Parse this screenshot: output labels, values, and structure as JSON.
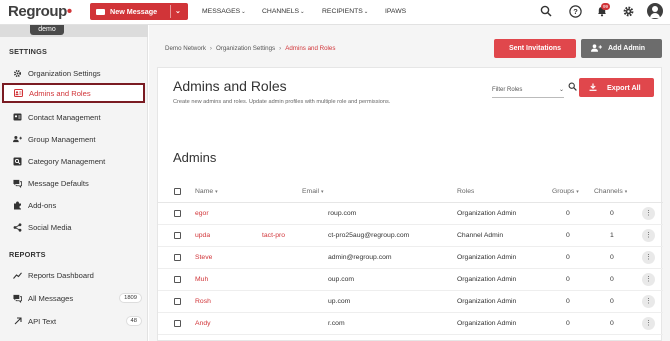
{
  "header": {
    "logo": "Regroup",
    "new_message_label": "New Message",
    "nav": [
      {
        "label": "MESSAGES",
        "has_dropdown": true
      },
      {
        "label": "CHANNELS",
        "has_dropdown": true
      },
      {
        "label": "RECIPIENTS",
        "has_dropdown": true
      },
      {
        "label": "IPAWS",
        "has_dropdown": false
      }
    ],
    "notification_count": "99"
  },
  "account_label": "demo",
  "sidebar": {
    "settings_heading": "SETTINGS",
    "settings_items": [
      {
        "label": "Organization Settings",
        "icon": "gear-icon"
      },
      {
        "label": "Admins and Roles",
        "icon": "admin-card-icon",
        "active": true
      },
      {
        "label": "Contact Management",
        "icon": "contact-card-icon"
      },
      {
        "label": "Group Management",
        "icon": "group-icon"
      },
      {
        "label": "Category Management",
        "icon": "category-icon"
      },
      {
        "label": "Message Defaults",
        "icon": "messages-icon"
      },
      {
        "label": "Add-ons",
        "icon": "puzzle-icon"
      },
      {
        "label": "Social Media",
        "icon": "share-icon"
      }
    ],
    "reports_heading": "REPORTS",
    "reports_items": [
      {
        "label": "Reports Dashboard",
        "icon": "trend-icon",
        "count": ""
      },
      {
        "label": "All Messages",
        "icon": "messages-icon",
        "count": "1809"
      },
      {
        "label": "API Text",
        "icon": "arrow-icon",
        "count": "48"
      }
    ]
  },
  "breadcrumb": [
    "Demo Network",
    "Organization Settings",
    "Admins and Roles"
  ],
  "actions": {
    "sent_invitations": "Sent Invitations",
    "add_admin": "Add Admin",
    "export_all": "Export All"
  },
  "page": {
    "title": "Admins and Roles",
    "subtitle": "Create new admins and roles. Update admin profiles with multiple role and permissions.",
    "filter_placeholder": "Filter Roles",
    "section_title": "Admins"
  },
  "table": {
    "columns": [
      "Name",
      "Email",
      "Roles",
      "Groups",
      "Channels"
    ],
    "rows": [
      {
        "name": "egor",
        "email": "roup.com",
        "role": "Organization Admin",
        "groups": "0",
        "channels": "0"
      },
      {
        "name": "upda",
        "name_extra": "tact-pro",
        "email": "ct-pro25aug@regroup.com",
        "role": "Channel Admin",
        "groups": "0",
        "channels": "1"
      },
      {
        "name": "Steve",
        "email": "admin@regroup.com",
        "role": "Organization Admin",
        "groups": "0",
        "channels": "0"
      },
      {
        "name": "Muh",
        "email": "oup.com",
        "role": "Organization Admin",
        "groups": "0",
        "channels": "0"
      },
      {
        "name": "Rosh",
        "email": "up.com",
        "role": "Organization Admin",
        "groups": "0",
        "channels": "0"
      },
      {
        "name": "Andy",
        "email": "r.com",
        "role": "Organization Admin",
        "groups": "0",
        "channels": "0"
      }
    ]
  },
  "colors": {
    "brand_red": "#d13438",
    "button_red": "#e0474c",
    "button_gray": "#6c6c6c",
    "active_border": "#7a1b22"
  }
}
